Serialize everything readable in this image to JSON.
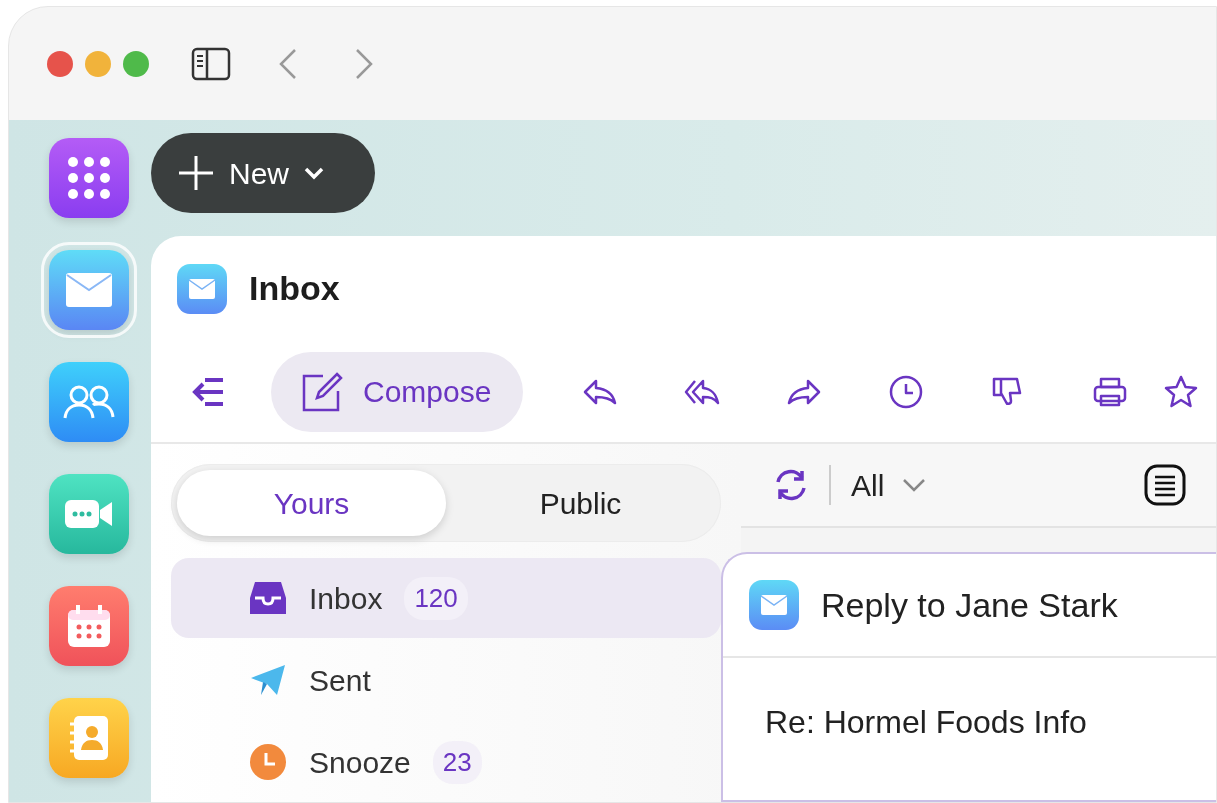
{
  "rail": [
    {
      "kind": "apps",
      "selected": false
    },
    {
      "kind": "mail",
      "selected": true
    },
    {
      "kind": "contacts",
      "selected": false
    },
    {
      "kind": "video",
      "selected": false
    },
    {
      "kind": "calendar",
      "selected": false
    },
    {
      "kind": "addressbook",
      "selected": false
    }
  ],
  "new_button": {
    "label": "New"
  },
  "header": {
    "title": "Inbox"
  },
  "toolbar": {
    "compose": "Compose"
  },
  "segments": [
    {
      "label": "Yours",
      "selected": true
    },
    {
      "label": "Public",
      "selected": false
    }
  ],
  "folders": [
    {
      "kind": "inbox",
      "label": "Inbox",
      "count": "120",
      "selected": true
    },
    {
      "kind": "sent",
      "label": "Sent",
      "selected": false
    },
    {
      "kind": "snooze",
      "label": "Snooze",
      "count": "23",
      "selected": false
    }
  ],
  "list_toolbar": {
    "filter": "All"
  },
  "reply_window": {
    "title": "Reply to Jane Stark",
    "subject": "Re: Hormel Foods Info"
  }
}
